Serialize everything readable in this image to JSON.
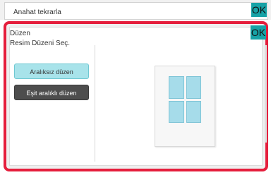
{
  "top": {
    "label": "Anahat tekrarla",
    "ok": "OK"
  },
  "panel": {
    "title": "Düzen",
    "subtitle": "Resim Düzeni Seç.",
    "ok": "OK",
    "options": [
      {
        "label": "Aralıksız düzen",
        "selected": true
      },
      {
        "label": "Eşit aralıklı düzen",
        "selected": false
      }
    ],
    "preview": {
      "rows": 2,
      "cols": 2
    }
  },
  "colors": {
    "accent_red": "#e51e3c",
    "ok_teal": "#17a2a6",
    "selected_fill": "#a8e3ea",
    "dark_button": "#4d4d4d",
    "preview_cell": "#a6dcea"
  }
}
